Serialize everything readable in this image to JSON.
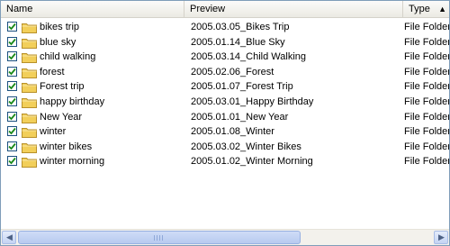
{
  "header": {
    "name_label": "Name",
    "preview_label": "Preview",
    "type_label": "Type"
  },
  "colors": {
    "folder": "#f2cf5a",
    "checkmark": "#1a8a1a",
    "border": "#7f9db9"
  },
  "rows": [
    {
      "checked": true,
      "name": "bikes trip",
      "preview": "2005.03.05_Bikes Trip",
      "type": "File Folder"
    },
    {
      "checked": true,
      "name": "blue sky",
      "preview": "2005.01.14_Blue Sky",
      "type": "File Folder"
    },
    {
      "checked": true,
      "name": "child walking",
      "preview": "2005.03.14_Child Walking",
      "type": "File Folder"
    },
    {
      "checked": true,
      "name": "forest",
      "preview": "2005.02.06_Forest",
      "type": "File Folder"
    },
    {
      "checked": true,
      "name": "Forest trip",
      "preview": "2005.01.07_Forest Trip",
      "type": "File Folder"
    },
    {
      "checked": true,
      "name": "happy  birthday",
      "preview": "2005.03.01_Happy  Birthday",
      "type": "File Folder"
    },
    {
      "checked": true,
      "name": "New Year",
      "preview": "2005.01.01_New Year",
      "type": "File Folder"
    },
    {
      "checked": true,
      "name": "winter",
      "preview": "2005.01.08_Winter",
      "type": "File Folder"
    },
    {
      "checked": true,
      "name": "winter bikes",
      "preview": "2005.03.02_Winter Bikes",
      "type": "File Folder"
    },
    {
      "checked": true,
      "name": "winter morning",
      "preview": "2005.01.02_Winter Morning",
      "type": "File Folder"
    }
  ]
}
